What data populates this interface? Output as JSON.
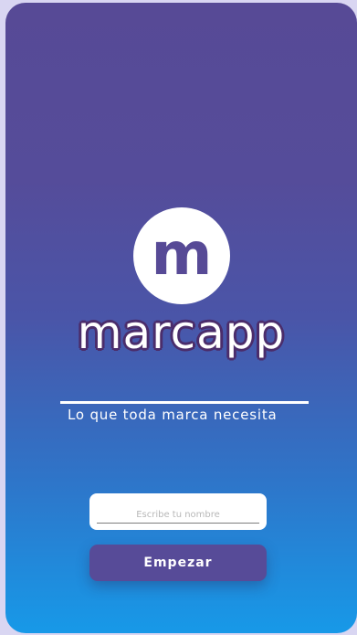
{
  "brand": {
    "logo_icon": "m-letter-logo-icon",
    "logo_letter": "m",
    "name": "marcapp",
    "tagline": "Lo que toda marca necesita"
  },
  "form": {
    "name_placeholder": "Escribe tu nombre",
    "name_value": "",
    "start_label": "Empezar"
  },
  "colors": {
    "gradient_top": "#574a96",
    "gradient_bottom": "#1799e8",
    "button": "#574b98",
    "logo_letter": "#574a96"
  }
}
